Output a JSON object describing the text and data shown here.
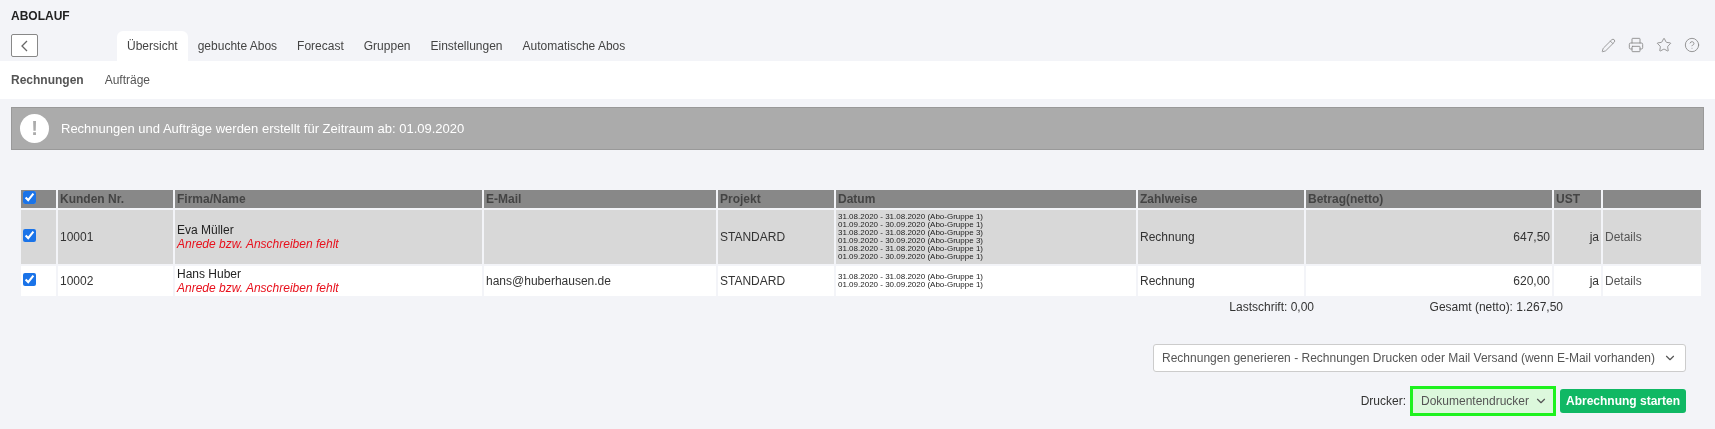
{
  "title": "ABOLAUF",
  "tabs": [
    {
      "label": "Übersicht",
      "selected": true
    },
    {
      "label": "gebuchte Abos",
      "selected": false
    },
    {
      "label": "Forecast",
      "selected": false
    },
    {
      "label": "Gruppen",
      "selected": false
    },
    {
      "label": "Einstellungen",
      "selected": false
    },
    {
      "label": "Automatische Abos",
      "selected": false
    }
  ],
  "subtabs": [
    {
      "label": "Rechnungen",
      "selected": true
    },
    {
      "label": "Aufträge",
      "selected": false
    }
  ],
  "alert": {
    "text": "Rechnungen und Aufträge werden erstellt für Zeitraum ab: 01.09.2020",
    "icon": "!"
  },
  "table": {
    "all_checked": true,
    "columns": [
      "Kunden Nr.",
      "Firma/Name",
      "E-Mail",
      "Projekt",
      "Datum",
      "Zahlweise",
      "Betrag(netto)",
      "UST"
    ],
    "rows": [
      {
        "checked": true,
        "customer_no": "10001",
        "name": "Eva Müller",
        "warning": "Anrede bzw. Anschreiben fehlt",
        "email": "",
        "project": "STANDARD",
        "dates": [
          "31.08.2020 - 31.08.2020 (Abo-Gruppe 1)",
          "01.09.2020 - 30.09.2020 (Abo-Gruppe 1)",
          "31.08.2020 - 31.08.2020 (Abo-Gruppe 3)",
          "01.09.2020 - 30.09.2020 (Abo-Gruppe 3)",
          "31.08.2020 - 31.08.2020 (Abo-Gruppe 1)",
          "01.09.2020 - 30.09.2020 (Abo-Gruppe 1)"
        ],
        "payment": "Rechnung",
        "amount": "647,50",
        "vat": "ja",
        "link": "Details"
      },
      {
        "checked": true,
        "customer_no": "10002",
        "name": "Hans Huber",
        "warning": "Anrede bzw. Anschreiben fehlt",
        "email": "hans@huberhausen.de",
        "project": "STANDARD",
        "dates": [
          "31.08.2020 - 31.08.2020 (Abo-Gruppe 1)",
          "01.09.2020 - 30.09.2020 (Abo-Gruppe 1)"
        ],
        "payment": "Rechnung",
        "amount": "620,00",
        "vat": "ja",
        "link": "Details"
      }
    ],
    "direct_debit": "Lastschrift: 0,00",
    "total": "Gesamt (netto): 1.267,50"
  },
  "action_select": {
    "value": "Rechnungen generieren - Rechnungen Drucken oder Mail Versand (wenn E-Mail vorhanden)"
  },
  "printer": {
    "label": "Drucker:",
    "value": "Dokumentendrucker",
    "highlighted": true
  },
  "start_button": "Abrechnung starten"
}
